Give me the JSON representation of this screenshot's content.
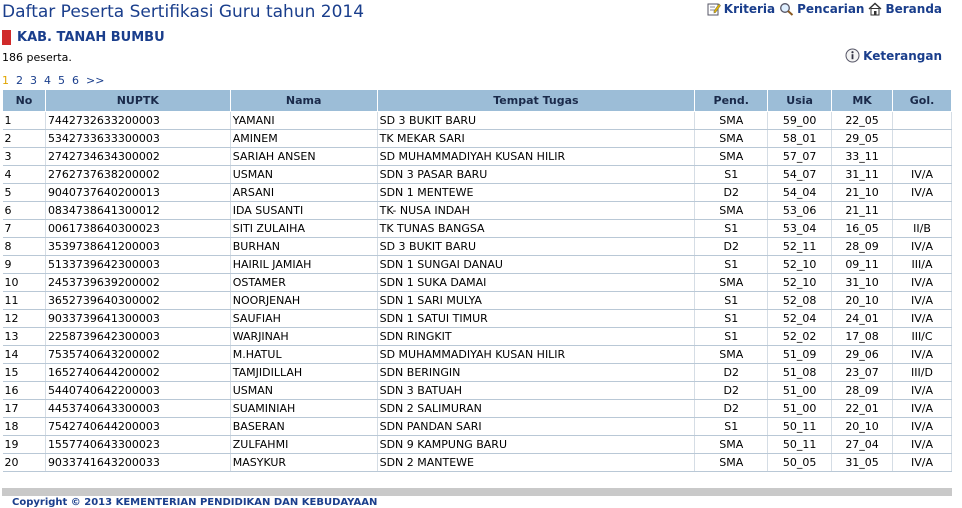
{
  "page": {
    "title": "Daftar Peserta Sertifikasi Guru tahun 2014",
    "region": "KAB. TANAH BUMBU",
    "count": "186 peserta.",
    "footer": "Copyright © 2013 KEMENTERIAN PENDIDIKAN DAN KEBUDAYAAN"
  },
  "nav": {
    "kriteria": "Kriteria",
    "pencarian": "Pencarian",
    "beranda": "Beranda",
    "keterangan": "Keterangan"
  },
  "pager": [
    "1",
    "2",
    "3",
    "4",
    "5",
    "6",
    ">>"
  ],
  "table": {
    "headers": [
      "No",
      "NUPTK",
      "Nama",
      "Tempat Tugas",
      "Pend.",
      "Usia",
      "MK",
      "Gol."
    ],
    "rows": [
      [
        "1",
        "7442732633200003",
        "YAMANI",
        "SD 3 BUKIT BARU",
        "SMA",
        "59_00",
        "22_05",
        ""
      ],
      [
        "2",
        "5342733633300003",
        "AMINEM",
        "TK MEKAR SARI",
        "SMA",
        "58_01",
        "29_05",
        ""
      ],
      [
        "3",
        "2742734634300002",
        "SARIAH ANSEN",
        "SD MUHAMMADIYAH KUSAN HILIR",
        "SMA",
        "57_07",
        "33_11",
        ""
      ],
      [
        "4",
        "2762737638200002",
        "USMAN",
        "SDN 3 PASAR BARU",
        "S1",
        "54_07",
        "31_11",
        "IV/A"
      ],
      [
        "5",
        "9040737640200013",
        "ARSANI",
        "SDN 1 MENTEWE",
        "D2",
        "54_04",
        "21_10",
        "IV/A"
      ],
      [
        "6",
        "0834738641300012",
        "IDA SUSANTI",
        "TK- NUSA INDAH",
        "SMA",
        "53_06",
        "21_11",
        ""
      ],
      [
        "7",
        "0061738640300023",
        "SITI ZULAIHA",
        "TK TUNAS BANGSA",
        "S1",
        "53_04",
        "16_05",
        "II/B"
      ],
      [
        "8",
        "3539738641200003",
        "BURHAN",
        "SD 3 BUKIT BARU",
        "D2",
        "52_11",
        "28_09",
        "IV/A"
      ],
      [
        "9",
        "5133739642300003",
        "HAIRIL JAMIAH",
        "SDN 1 SUNGAI DANAU",
        "S1",
        "52_10",
        "09_11",
        "III/A"
      ],
      [
        "10",
        "2453739639200002",
        "OSTAMER",
        "SDN 1 SUKA DAMAI",
        "SMA",
        "52_10",
        "31_10",
        "IV/A"
      ],
      [
        "11",
        "3652739640300002",
        "NOORJENAH",
        "SDN 1 SARI MULYA",
        "S1",
        "52_08",
        "20_10",
        "IV/A"
      ],
      [
        "12",
        "9033739641300003",
        "SAUFIAH",
        "SDN 1 SATUI TIMUR",
        "S1",
        "52_04",
        "24_01",
        "IV/A"
      ],
      [
        "13",
        "2258739642300003",
        "WARJINAH",
        "SDN RINGKIT",
        "S1",
        "52_02",
        "17_08",
        "III/C"
      ],
      [
        "14",
        "7535740643200002",
        "M.HATUL",
        "SD MUHAMMADIYAH KUSAN HILIR",
        "SMA",
        "51_09",
        "29_06",
        "IV/A"
      ],
      [
        "15",
        "1652740644200002",
        "TAMJIDILLAH",
        "SDN BERINGIN",
        "D2",
        "51_08",
        "23_07",
        "III/D"
      ],
      [
        "16",
        "5440740642200003",
        "USMAN",
        "SDN 3 BATUAH",
        "D2",
        "51_00",
        "28_09",
        "IV/A"
      ],
      [
        "17",
        "4453740643300003",
        "SUAMINIAH",
        "SDN 2 SALIMURAN",
        "D2",
        "51_00",
        "22_01",
        "IV/A"
      ],
      [
        "18",
        "7542740644200003",
        "BASERAN",
        "SDN PANDAN SARI",
        "S1",
        "50_11",
        "20_10",
        "IV/A"
      ],
      [
        "19",
        "1557740643300023",
        "ZULFAHMI",
        "SDN 9 KAMPUNG BARU",
        "SMA",
        "50_11",
        "27_04",
        "IV/A"
      ],
      [
        "20",
        "9033741643200033",
        "MASYKUR",
        "SDN 2 MANTEWE",
        "SMA",
        "50_05",
        "31_05",
        "IV/A"
      ]
    ]
  },
  "colors": {
    "title": "#1a3e8c",
    "header_bg": "#9cbdd7",
    "accent_red": "#d02a2a",
    "pager_current": "#e0a400"
  }
}
